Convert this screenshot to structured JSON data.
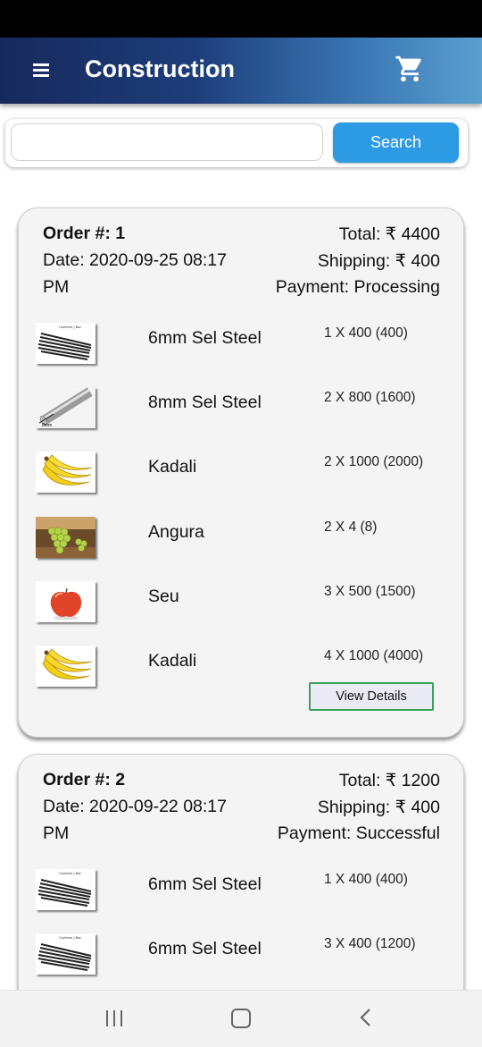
{
  "app": {
    "title": "Construction",
    "menu_icon": "hamburger-menu-icon",
    "cart_icon": "shopping-cart-icon",
    "accent_color": "#2d9be3"
  },
  "search": {
    "value": "",
    "placeholder": "",
    "button_label": "Search"
  },
  "orders": [
    {
      "order_label": "Order #: 1",
      "date_line1": "Date: 2020-09-25 08:17",
      "date_line2": "PM",
      "total": "Total: ₹ 4400",
      "shipping": "Shipping: ₹ 400",
      "payment": "Payment: Processing",
      "items": [
        {
          "name": "6mm Sel Steel",
          "qty": "1 X 400 (400)",
          "image": "steel-bars-image"
        },
        {
          "name": "8mm Sel Steel",
          "qty": "2 X 800 (1600)",
          "image": "steel-rod-image"
        },
        {
          "name": "Kadali",
          "qty": "2 X 1000 (2000)",
          "image": "banana-image"
        },
        {
          "name": "Angura",
          "qty": "2 X 4 (8)",
          "image": "grapes-image"
        },
        {
          "name": "Seu",
          "qty": "3 X 500 (1500)",
          "image": "apple-image"
        },
        {
          "name": "Kadali",
          "qty": "4 X 1000 (4000)",
          "image": "banana-image"
        }
      ],
      "view_details_label": "View Details"
    },
    {
      "order_label": "Order #: 2",
      "date_line1": "Date: 2020-09-22 08:17",
      "date_line2": "PM",
      "total": "Total: ₹ 1200",
      "shipping": "Shipping: ₹ 400",
      "payment": "Payment: Successful",
      "items": [
        {
          "name": "6mm Sel Steel",
          "qty": "1 X 400 (400)",
          "image": "steel-bars-image"
        },
        {
          "name": "6mm Sel Steel",
          "qty": "3 X 400 (1200)",
          "image": "steel-bars-image"
        }
      ]
    }
  ],
  "system_nav": {
    "recent_icon": "recent-apps-icon",
    "home_icon": "home-icon",
    "back_icon": "back-icon"
  }
}
